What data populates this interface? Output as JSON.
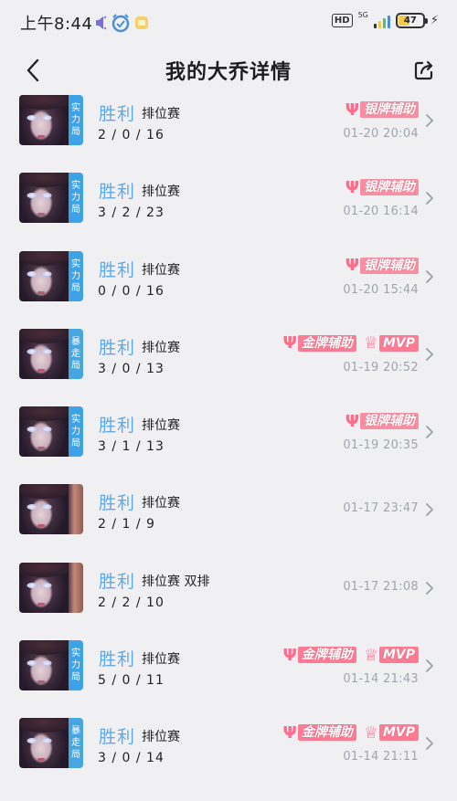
{
  "status_bar": {
    "time": "上午8:44",
    "icons": [
      "speaker-icon",
      "alarm-icon",
      "note-icon"
    ],
    "hd": "HD",
    "network": "5G",
    "battery": "47"
  },
  "header": {
    "title": "我的大乔详情",
    "back_icon": "chevron-left-icon",
    "share_icon": "share-icon"
  },
  "colors": {
    "result_blue": "#5fa8e8",
    "tag_blue": "#3ea3e6",
    "badge_pink": "#ff7a93",
    "time_gray": "#a0a5ad"
  },
  "matches": [
    {
      "result": "胜利",
      "mode": "排位赛",
      "kda": "2 / 0 / 16",
      "time": "01-20 20:04",
      "tag": "实力局",
      "badges": [
        "银牌辅助"
      ]
    },
    {
      "result": "胜利",
      "mode": "排位赛",
      "kda": "3 / 2 / 23",
      "time": "01-20 16:14",
      "tag": "实力局",
      "badges": [
        "银牌辅助"
      ]
    },
    {
      "result": "胜利",
      "mode": "排位赛",
      "kda": "0 / 0 / 16",
      "time": "01-20 15:44",
      "tag": "实力局",
      "badges": [
        "银牌辅助"
      ]
    },
    {
      "result": "胜利",
      "mode": "排位赛",
      "kda": "3 / 0 / 13",
      "time": "01-19 20:52",
      "tag": "暴走局",
      "badges": [
        "金牌辅助",
        "MVP"
      ]
    },
    {
      "result": "胜利",
      "mode": "排位赛",
      "kda": "3 / 1 / 13",
      "time": "01-19 20:35",
      "tag": "实力局",
      "badges": [
        "银牌辅助"
      ]
    },
    {
      "result": "胜利",
      "mode": "排位赛",
      "kda": "2 / 1 / 9",
      "time": "01-17 23:47",
      "tag": "",
      "badges": []
    },
    {
      "result": "胜利",
      "mode": "排位赛 双排",
      "kda": "2 / 2 / 10",
      "time": "01-17 21:08",
      "tag": "",
      "badges": []
    },
    {
      "result": "胜利",
      "mode": "排位赛",
      "kda": "5 / 0 / 11",
      "time": "01-14 21:43",
      "tag": "实力局",
      "badges": [
        "金牌辅助",
        "MVP"
      ]
    },
    {
      "result": "胜利",
      "mode": "排位赛",
      "kda": "3 / 0 / 14",
      "time": "01-14 21:11",
      "tag": "暴走局",
      "badges": [
        "金牌辅助",
        "MVP"
      ]
    }
  ]
}
